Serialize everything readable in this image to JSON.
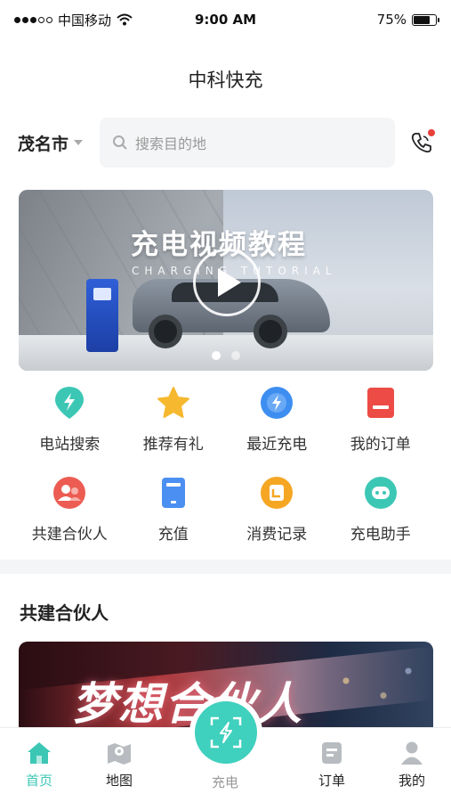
{
  "status_bar": {
    "carrier": "中国移动",
    "time": "9:00 AM",
    "battery": "75%",
    "battery_level": 0.75
  },
  "header": {
    "title": "中科快充"
  },
  "search": {
    "city": "茂名市",
    "placeholder": "搜索目的地"
  },
  "banner": {
    "title": "充电视频教程",
    "subtitle": "CHARGING TUTORIAL",
    "active_page": 1,
    "page_count": 2
  },
  "quick_actions": [
    {
      "label": "电站搜索",
      "icon": "location-bolt-icon",
      "color": "#3cc7b5"
    },
    {
      "label": "推荐有礼",
      "icon": "star-icon",
      "color": "#f5b82e"
    },
    {
      "label": "最近充电",
      "icon": "bolt-circle-icon",
      "color": "#3d8ef0"
    },
    {
      "label": "我的订单",
      "icon": "order-icon",
      "color": "#ec4c45"
    },
    {
      "label": "共建合伙人",
      "icon": "partner-icon",
      "color": "#ec5c52"
    },
    {
      "label": "充值",
      "icon": "recharge-icon",
      "color": "#4b8ff2"
    },
    {
      "label": "消费记录",
      "icon": "record-icon",
      "color": "#f5a623"
    },
    {
      "label": "充电助手",
      "icon": "assistant-icon",
      "color": "#3cc7b5"
    }
  ],
  "partner_section": {
    "title": "共建合伙人",
    "banner_text": "梦想合伙人"
  },
  "tabbar": {
    "items": [
      {
        "label": "首页",
        "icon": "home-icon"
      },
      {
        "label": "地图",
        "icon": "map-icon"
      },
      {
        "label": "充电",
        "icon": "scan-charge-icon"
      },
      {
        "label": "订单",
        "icon": "order-doc-icon"
      },
      {
        "label": "我的",
        "icon": "user-icon"
      }
    ],
    "active_color": "#3cc7b5",
    "accent": "#3fd0be"
  }
}
